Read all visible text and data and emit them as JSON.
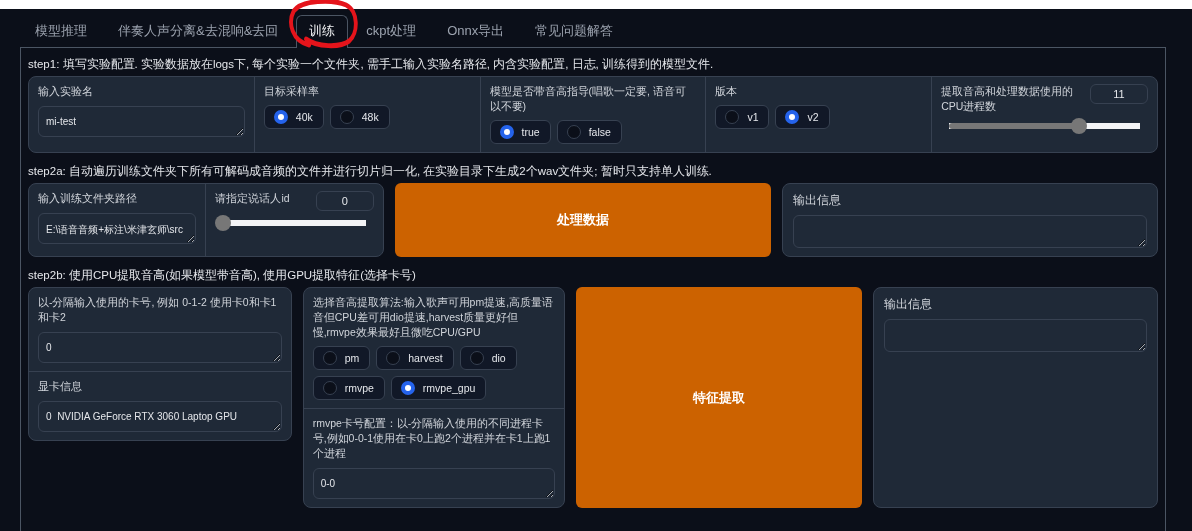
{
  "tabs": [
    {
      "label": "模型推理",
      "selected": false
    },
    {
      "label": "伴奏人声分离&去混响&去回",
      "selected": false
    },
    {
      "label": "训练",
      "selected": true
    },
    {
      "label": "ckpt处理",
      "selected": false
    },
    {
      "label": "Onnx导出",
      "selected": false
    },
    {
      "label": "常见问题解答",
      "selected": false
    }
  ],
  "steps": [
    {
      "title": "step1: 填写实验配置. 实验数据放在logs下, 每个实验一个文件夹, 需手工输入实验名路径, 内含实验配置, 日志, 训练得到的模型文件.",
      "panels": [
        {
          "kind": "group",
          "cells": [
            {
              "kind": "text",
              "label": "输入实验名",
              "value": "mi-test"
            },
            {
              "kind": "radio",
              "label": "目标采样率",
              "options": [
                {
                  "label": "40k",
                  "selected": true
                },
                {
                  "label": "48k",
                  "selected": false
                }
              ]
            },
            {
              "kind": "radio",
              "label": "模型是否带音高指导(唱歌一定要, 语音可以不要)",
              "options": [
                {
                  "label": "true",
                  "selected": true
                },
                {
                  "label": "false",
                  "selected": false
                }
              ]
            },
            {
              "kind": "radio",
              "label": "版本",
              "options": [
                {
                  "label": "v1",
                  "selected": false
                },
                {
                  "label": "v2",
                  "selected": true
                }
              ]
            },
            {
              "kind": "slider",
              "label": "提取音高和处理数据使用的CPU进程数",
              "value": "11",
              "level": 0.68
            }
          ]
        }
      ]
    },
    {
      "title": "step2a: 自动遍历训练文件夹下所有可解码成音频的文件并进行切片归一化, 在实验目录下生成2个wav文件夹; 暂时只支持单人训练.",
      "panels": [
        {
          "kind": "group",
          "cells": [
            {
              "kind": "text",
              "label": "输入训练文件夹路径",
              "value": "E:\\语音音频+标注\\米津玄师\\src"
            },
            {
              "kind": "slider",
              "label": "请指定说话人id",
              "value": "0",
              "level": 0
            }
          ]
        },
        {
          "kind": "button",
          "label": "处理数据"
        },
        {
          "kind": "output",
          "label": "输出信息"
        }
      ]
    },
    {
      "title": "step2b: 使用CPU提取音高(如果模型带音高), 使用GPU提取特征(选择卡号)",
      "panels": [
        {
          "kind": "group",
          "cells": [
            {
              "kind": "text",
              "label": "以-分隔输入使用的卡号, 例如 0-1-2 使用卡0和卡1和卡2",
              "value": "0"
            },
            {
              "kind": "text",
              "label": "显卡信息",
              "value": "0\tNVIDIA GeForce RTX 3060 Laptop GPU"
            }
          ]
        },
        {
          "kind": "group",
          "cells": [
            {
              "kind": "radio",
              "label": "选择音高提取算法:输入歌声可用pm提速,高质量语音但CPU差可用dio提速,harvest质量更好但慢,rmvpe效果最好且微吃CPU/GPU",
              "options": [
                {
                  "label": "pm",
                  "selected": false
                },
                {
                  "label": "harvest",
                  "selected": false
                },
                {
                  "label": "dio",
                  "selected": false
                },
                {
                  "label": "rmvpe",
                  "selected": false
                },
                {
                  "label": "rmvpe_gpu",
                  "selected": true
                }
              ]
            },
            {
              "kind": "text",
              "label": "rmvpe卡号配置：以-分隔输入使用的不同进程卡号,例如0-0-1使用在卡0上跑2个进程并在卡1上跑1个进程",
              "value": "0-0"
            }
          ]
        },
        {
          "kind": "button",
          "label": "特征提取"
        },
        {
          "kind": "output",
          "label": "输出信息"
        }
      ]
    }
  ]
}
